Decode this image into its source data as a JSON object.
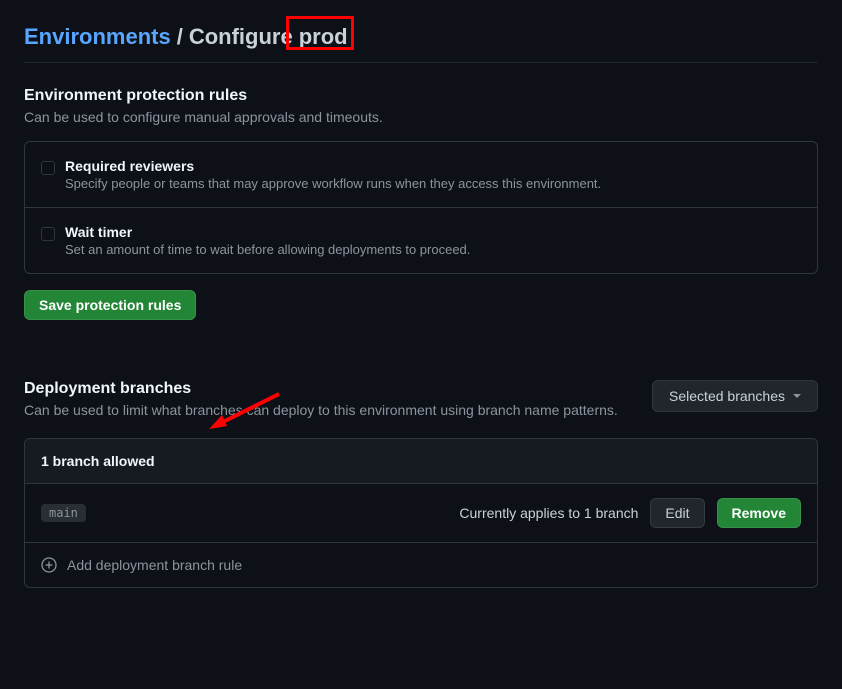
{
  "breadcrumb": {
    "link": "Environments",
    "separator": "/",
    "configure": "Configure",
    "env": "prod"
  },
  "protection": {
    "title": "Environment protection rules",
    "desc": "Can be used to configure manual approvals and timeouts.",
    "rules": [
      {
        "label": "Required reviewers",
        "desc": "Specify people or teams that may approve workflow runs when they access this environment."
      },
      {
        "label": "Wait timer",
        "desc": "Set an amount of time to wait before allowing deployments to proceed."
      }
    ],
    "save_label": "Save protection rules"
  },
  "deployment": {
    "title": "Deployment branches",
    "desc": "Can be used to limit what branches can deploy to this environment using branch name patterns.",
    "dropdown_label": "Selected branches",
    "allowed_header": "1 branch allowed",
    "branch_name": "main",
    "applies_text": "Currently applies to 1 branch",
    "edit_label": "Edit",
    "remove_label": "Remove",
    "add_rule_label": "Add deployment branch rule"
  }
}
